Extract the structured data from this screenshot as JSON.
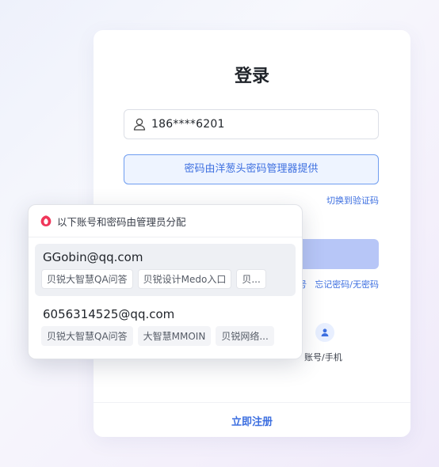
{
  "login": {
    "title": "登录",
    "account_value": "186****6201",
    "pm_banner": "密码由洋葱头密码管理器提供",
    "switch_link": "切换到验证码",
    "links_partial": "号",
    "forgot_link": "忘记密码/无密码",
    "method_label": "账号/手机",
    "register_link": "立即注册"
  },
  "popup": {
    "header": "以下账号和密码由管理员分配",
    "accounts": [
      {
        "email": "GGobin@qq.com",
        "tags": [
          "贝锐大智慧QA问答",
          "贝锐设计Medo入口",
          "贝..."
        ]
      },
      {
        "email": "6056314525@qq.com",
        "tags": [
          "贝锐大智慧QA问答",
          "大智慧MMOIN",
          "贝锐网络..."
        ]
      }
    ]
  },
  "colors": {
    "accent": "#3d6fe0",
    "banner_bg": "#eef4ff",
    "login_button": "#b7c6f7",
    "brand": "#f0375a"
  }
}
